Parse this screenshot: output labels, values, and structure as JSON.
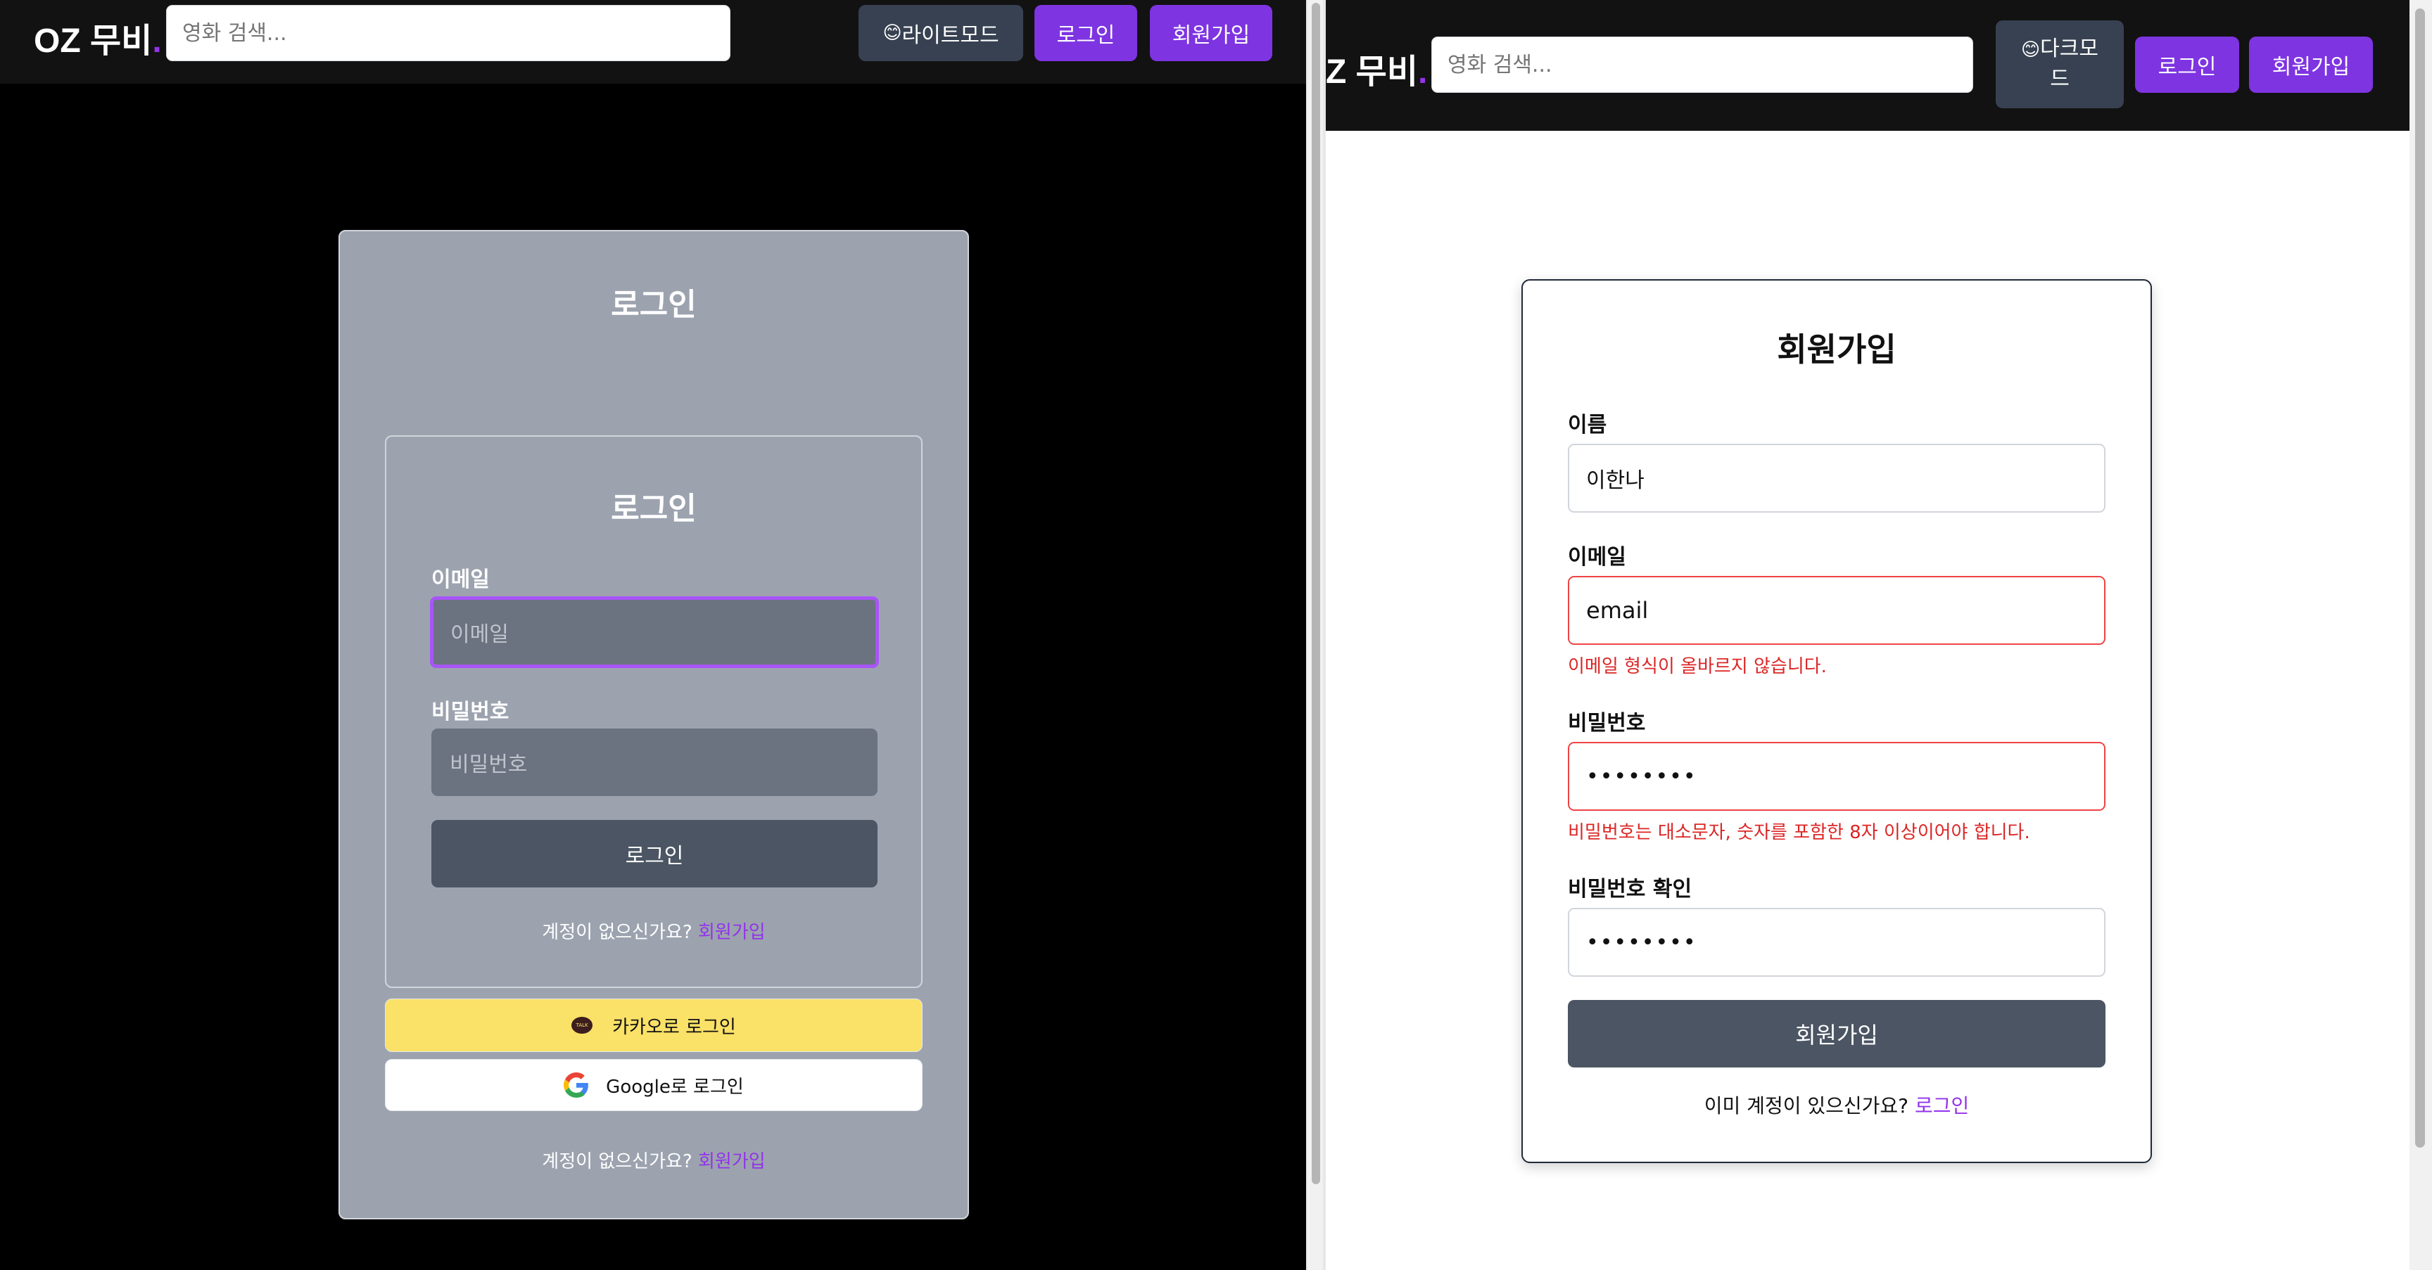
{
  "left": {
    "navbar": {
      "logo": "OZ 무비",
      "logo_dot": ".",
      "search_placeholder": "영화 검색...",
      "theme_toggle": {
        "emoji": "😊",
        "label": "라이트모드"
      },
      "login_label": "로그인",
      "signup_label": "회원가입"
    },
    "panel": {
      "title": "로그인",
      "inner_card": {
        "title": "로그인",
        "email_label": "이메일",
        "email_placeholder": "이메일",
        "password_label": "비밀번호",
        "password_placeholder": "비밀번호",
        "submit_label": "로그인",
        "footer_text": "계정이 없으신가요?",
        "footer_link": "회원가입"
      },
      "kakao_label": "카카오로 로그인",
      "kakao_icon_text": "TALK",
      "google_label": "Google로 로그인",
      "footer_text": "계정이 없으신가요?",
      "footer_link": "회원가입"
    }
  },
  "right": {
    "navbar": {
      "logo": "Z 무비",
      "logo_dot": ".",
      "search_placeholder": "영화 검색...",
      "theme_toggle": {
        "emoji": "😊",
        "label_line1": "다크모",
        "label_line2": "드"
      },
      "login_label": "로그인",
      "signup_label": "회원가입"
    },
    "signup_card": {
      "title": "회원가입",
      "name_label": "이름",
      "name_value": "이한나",
      "email_label": "이메일",
      "email_value": "email",
      "email_error": "이메일 형식이 올바르지 않습니다.",
      "password_label": "비밀번호",
      "password_value": "••••••••",
      "password_error": "비밀번호는 대소문자, 숫자를 포함한 8자 이상이어야 합니다.",
      "confirm_label": "비밀번호 확인",
      "confirm_value": "••••••••",
      "submit_label": "회원가입",
      "footer_text": "이미 계정이 있으신가요?",
      "footer_link": "로그인"
    }
  },
  "colors": {
    "accent_purple": "#7e34e1",
    "error_red": "#ef4444",
    "kakao_yellow": "#fae168",
    "panel_gray": "#9ca3af",
    "navbar_black": "#121212"
  }
}
